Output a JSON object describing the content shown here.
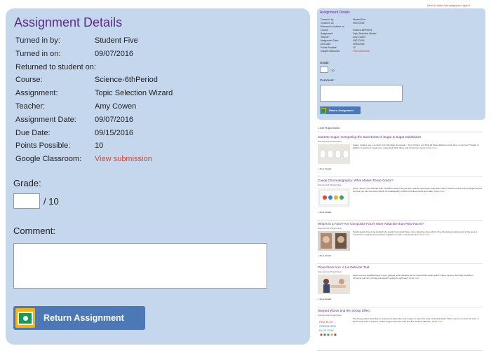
{
  "assignment": {
    "title": "Assignment Details",
    "details": [
      {
        "label": "Turned in by:",
        "value": "Student Five"
      },
      {
        "label": "Turned in on:",
        "value": "09/07/2016"
      },
      {
        "label": "Returned to student on:",
        "value": ""
      },
      {
        "label": "Course:",
        "value": "Science-6thPeriod"
      },
      {
        "label": "Assignment:",
        "value": "Topic Selection Wizard"
      },
      {
        "label": "Teacher:",
        "value": "Amy Cowen"
      },
      {
        "label": "Assignment Date:",
        "value": "09/07/2016"
      },
      {
        "label": "Due Date:",
        "value": "09/15/2016"
      },
      {
        "label": "Points Possible:",
        "value": "10"
      },
      {
        "label": "Google Classroom:",
        "value": "View submission"
      }
    ],
    "grade_label": "Grade:",
    "grade_value": "",
    "grade_out_of": "/ 10",
    "comment_label": "Comment:",
    "comment_value": "",
    "return_button_label": "Return Assignment"
  },
  "mini_panel": {
    "hint": "Need to delete this assignment again?",
    "title": "Assignment Details",
    "details": [
      {
        "label": "Turned in by:",
        "value": "Student Five"
      },
      {
        "label": "Turned in on:",
        "value": "09/07/2016"
      },
      {
        "label": "Returned to student on:",
        "value": ""
      },
      {
        "label": "Course:",
        "value": "Science-6thPeriod"
      },
      {
        "label": "Assignment:",
        "value": "Topic Selection Wizard"
      },
      {
        "label": "Teacher:",
        "value": "Amy Cowen"
      },
      {
        "label": "Assignment Date:",
        "value": "09/07/2016"
      },
      {
        "label": "Due Date:",
        "value": "09/15/2016"
      },
      {
        "label": "Points Possible:",
        "value": "10"
      },
      {
        "label": "Google Classroom:",
        "value": "View submission"
      }
    ],
    "grade_label": "Grade:",
    "grade_out_of": "/ 10",
    "comment_label": "Comment:",
    "return_button_label": "Return Assignment"
  },
  "project_ideas": {
    "count_label": "1,039 Project Ideas",
    "items": [
      {
        "title": "Sweeter Sugar: Comparing the Sweetness of Sugar & Sugar Substitutes",
        "meta": "Science Fair Project Idea",
        "summary": "Cakes, cookies, pie, ice cream, hot chocolate, lemonade... Yum! Is there one thing all these delicious treats have in common? Sugar! In addition to giving us sweetness, sugar adds bulk, flavor and structure to foods.",
        "more": "Read more",
        "details": "+ More Details"
      },
      {
        "title": "Candy Chromatography: What Makes Those Colors?",
        "meta": "Science Fair Project Idea",
        "summary": "Quick, what is your favorite color of M&M's candy? Did you ever wonder what dyes make each color? Check out this science project to find out how you can use some simple chromatography to learn how food colors are made.",
        "more": "Read more",
        "details": "+ More Details"
      },
      {
        "title": "What's in a Face? Are Composite Faces More Attractive than Real Faces?",
        "meta": "Science Fair Project Idea",
        "summary": "Psychologists have long studied why people find certain faces more attractive than others. One interesting method used in the area of research is morphing several faces together to make a composite face.",
        "more": "Read more",
        "details": "+ More Details"
      },
      {
        "title": "Pinocchio's Arm: A Lie Detector Test",
        "meta": "Science Fair Project Idea",
        "summary": "Have you ever watched a spy's eyes, gauges, and indicators as he moves while under guard? Have you ever felt really bad when someone got hurt or things just weren't going the right way?",
        "more": "Read more",
        "details": "+ More Details"
      },
      {
        "title": "Warped Words and the Stroop Effect",
        "meta": "Science Fair Project Idea",
        "summary": "The Stroop effect describes an experiment about the time it takes to name the color of printed letters. When you try to name the color in which each word is printed, it takes longer when the color and the word are different.",
        "more": "Read more",
        "details": "+ More Details"
      }
    ]
  },
  "colors": {
    "panel_bg": "#c5d7ec",
    "title": "#5b2d8f",
    "link": "#d9452f",
    "button": "#4c78b5"
  }
}
